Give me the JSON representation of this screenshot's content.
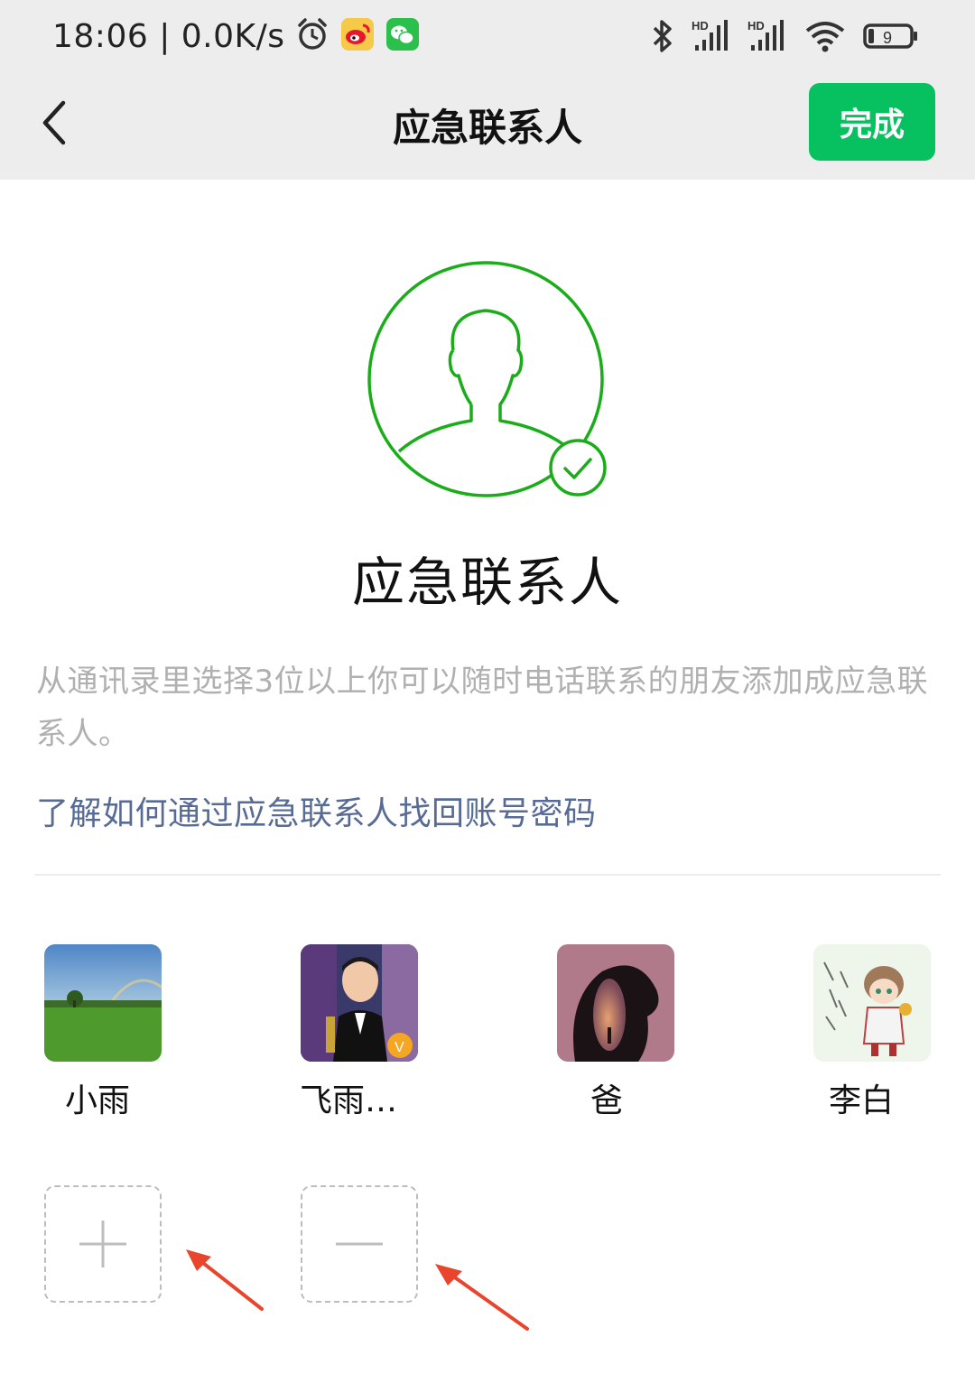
{
  "status_bar": {
    "time": "18:06 | 0.0K/s",
    "battery": "9"
  },
  "nav": {
    "title": "应急联系人",
    "done_label": "完成"
  },
  "main": {
    "hero_title": "应急联系人",
    "description": "从通讯录里选择3位以上你可以随时电话联系的朋友添加成应急联系人。",
    "learn_link": "了解如何通过应急联系人找回账号密码"
  },
  "contacts": [
    {
      "name": "小雨"
    },
    {
      "name": "飞雨…"
    },
    {
      "name": "爸"
    },
    {
      "name": "李白"
    }
  ],
  "colors": {
    "accent": "#07c160",
    "link": "#576b95",
    "annotation_arrow": "#e8452c"
  }
}
